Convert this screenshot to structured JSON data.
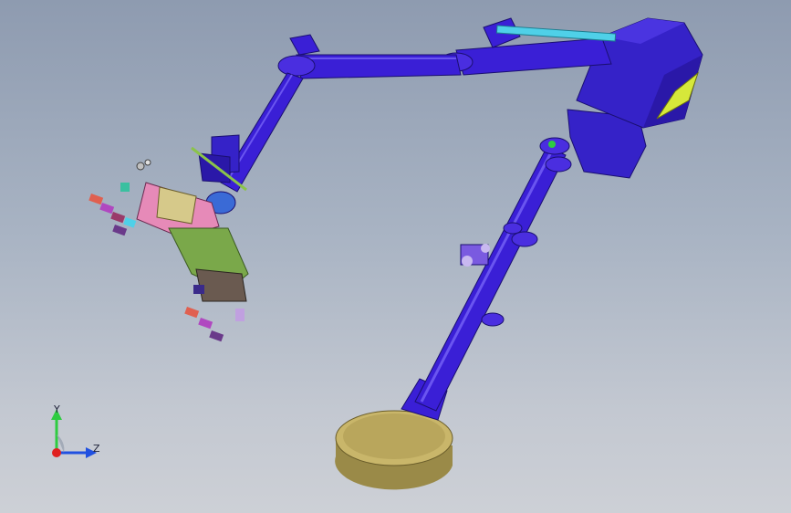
{
  "viewport": {
    "background_top": "#8e9bb0",
    "background_bottom": "#cdd0d6"
  },
  "model": {
    "arm_color": "#3a1fd6",
    "arm_highlight": "#6a55f0",
    "motor_color": "#3522c8",
    "cylinder_color": "#4fd0e8",
    "bracket_color": "#d6e83a",
    "base_color": "#c9b66a",
    "base_top_color": "#b8a55a",
    "gripper_plate_color": "#e68ab8",
    "gripper_support_color": "#8bc34a"
  },
  "triad": {
    "y_label": "Y",
    "z_label": "Z",
    "y_color": "#2ecc40",
    "z_color": "#2050e0",
    "x_color": "#e02020"
  }
}
